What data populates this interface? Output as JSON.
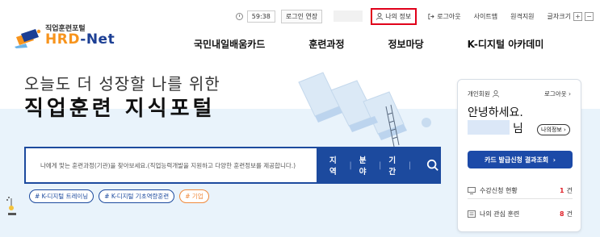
{
  "utility": {
    "timer": "59:38",
    "extend": "로그인 연장",
    "my_info": "나의 정보",
    "logout": "로그아웃",
    "sitemap": "사이트맵",
    "remote_support": "원격지원",
    "font_size": "글자크기",
    "font_plus": "+",
    "font_minus": "−"
  },
  "logo": {
    "small_text": "직업훈련포털",
    "brand_hrd": "HRD",
    "brand_dash": "-",
    "brand_net": "Net"
  },
  "nav": [
    "국민내일배움카드",
    "훈련과정",
    "정보마당",
    "K-디지털 아카데미"
  ],
  "hero": {
    "line1": "오늘도 더 성장할 나를 위한",
    "line2": "직업훈련 지식포털"
  },
  "search": {
    "placeholder": "나에게 맞는 훈련과정(기관)을 찾아보세요.(직업능력개발을 지원하고 다양한 훈련정보를 제공합니다.)",
    "filters": [
      "지역",
      "분야",
      "기간"
    ],
    "separator": "|"
  },
  "tags": [
    "# K-디지털 트레이닝",
    "# K-디지털 기초역량훈련",
    "# 기업"
  ],
  "panel": {
    "member_type": "개인회원",
    "logout": "로그아웃",
    "greeting": "안녕하세요.",
    "name_suffix": "님",
    "my_info": "나의정보",
    "card_status": "카드 발급신청 결과조회",
    "rows": [
      {
        "label": "수강신청 현황",
        "count": "1",
        "unit": "건"
      },
      {
        "label": "나의 관심 훈련",
        "count": "8",
        "unit": "건"
      }
    ]
  },
  "colors": {
    "brand_blue": "#1c4a9e",
    "brand_orange": "#f7941d",
    "highlight_red": "#e0001a",
    "count_red": "#e0232b"
  }
}
